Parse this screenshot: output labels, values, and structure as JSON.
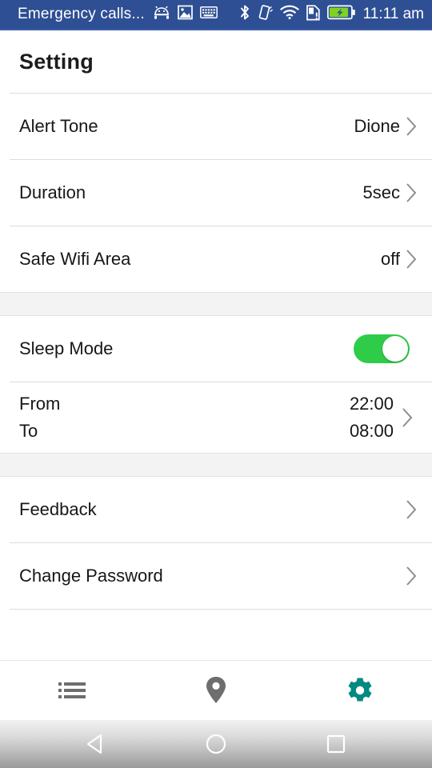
{
  "statusbar": {
    "carrier_text": "Emergency calls...",
    "clock": "11:11 am",
    "left_icons": [
      "android-robot-icon",
      "image-icon",
      "keyboard-icon"
    ],
    "right_icons": [
      "bluetooth-icon",
      "vibrate-icon",
      "wifi-icon",
      "sim-alert-icon",
      "battery-charging-icon"
    ],
    "background_color": "#2e4f94",
    "battery_color": "#7ed321"
  },
  "header": {
    "title": "Setting"
  },
  "sections": [
    {
      "rows": [
        {
          "label": "Alert Tone",
          "value": "Dione",
          "type": "value-chevron"
        },
        {
          "label": "Duration",
          "value": "5sec",
          "type": "value-chevron"
        },
        {
          "label": "Safe Wifi Area",
          "value": "off",
          "type": "value-chevron"
        }
      ]
    },
    {
      "rows": [
        {
          "label": "Sleep Mode",
          "value": "on",
          "type": "toggle"
        },
        {
          "label_from": "From",
          "label_to": "To",
          "value_from": "22:00",
          "value_to": "08:00",
          "type": "time-range"
        }
      ]
    },
    {
      "rows": [
        {
          "label": "Feedback",
          "value": "",
          "type": "chevron"
        },
        {
          "label": "Change Password",
          "value": "",
          "type": "chevron"
        }
      ]
    }
  ],
  "tabbar": {
    "tabs": [
      {
        "name": "list-tab",
        "icon": "list-icon",
        "active": false
      },
      {
        "name": "location-tab",
        "icon": "location-pin-icon",
        "active": false
      },
      {
        "name": "settings-tab",
        "icon": "gear-icon",
        "active": true
      }
    ],
    "active_color": "#028a82",
    "inactive_color": "#6e6e6e"
  },
  "navbar": {
    "buttons": [
      {
        "name": "back-button",
        "icon": "triangle-left-icon"
      },
      {
        "name": "home-button",
        "icon": "circle-icon"
      },
      {
        "name": "recents-button",
        "icon": "square-icon"
      }
    ]
  },
  "colors": {
    "toggle_on": "#2ecc49",
    "divider": "#dcdcdc",
    "section_gap": "#f3f3f3",
    "text": "#171717"
  }
}
